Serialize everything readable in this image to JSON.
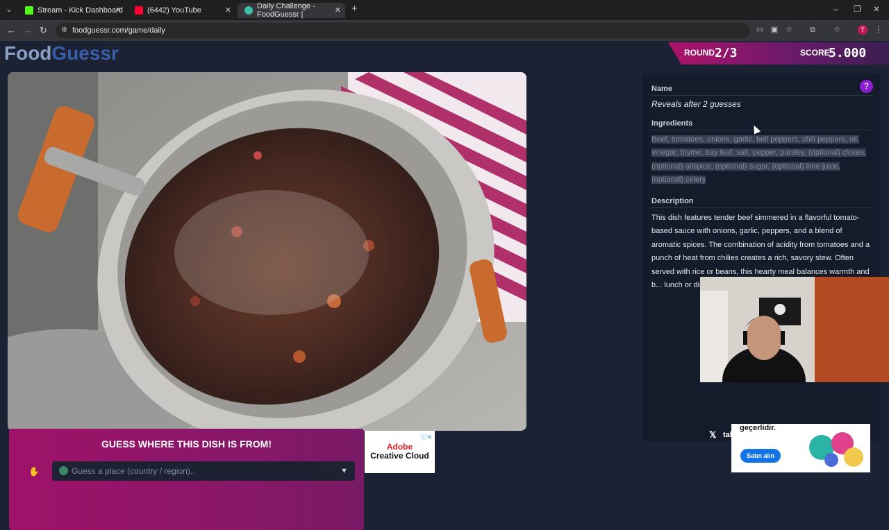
{
  "browser": {
    "tabs": [
      {
        "title": "Stream - Kick Dashboard",
        "favicon_color": "#53fc18"
      },
      {
        "title": "(6442) YouTube",
        "favicon_color": "#ff0033"
      },
      {
        "title": "Daily Challenge - FoodGuessr |",
        "favicon_color": "#3bbfa0"
      }
    ],
    "url": "foodguessr.com/game/daily",
    "profile_initial": "T"
  },
  "game": {
    "logo_food": "Food",
    "logo_guessr": "Guessr",
    "round_label": "ROUND",
    "round_value": "2/3",
    "score_label": "SCORE",
    "score_value": "5.000"
  },
  "panel": {
    "name_title": "Name",
    "name_value": "Reveals after 2 guesses",
    "ingredients_title": "Ingredients",
    "ingredients": "Beef, tomatoes, onions, garlic, bell peppers, chili peppers, oil, vinegar, thyme, bay leaf, salt, pepper, parsley, (optional) cloves, (optional) allspice, (optional) sugar, (optional) lime juice, (optional) celery",
    "description_title": "Description",
    "description": "This dish features tender beef simmered in a flavorful tomato-based sauce with onions, garlic, peppers, and a blend of aromatic spices. The combination of acidity from tomatoes and a punch of heat from chilies creates a rich, savory stew. Often served with rice or beans, this hearty meal balances warmth and b... lunch or dinne..."
  },
  "guess": {
    "title": "GUESS WHERE THIS DISH IS FROM!",
    "placeholder": "Guess a place (country / region).."
  },
  "ads": {
    "adobe_line1": "Adobe",
    "adobe_line2": "Creative Cloud",
    "overlay_text": "geçerlidir.",
    "overlay_button": "Satın alın",
    "twitter_handle": "talhadnder"
  }
}
